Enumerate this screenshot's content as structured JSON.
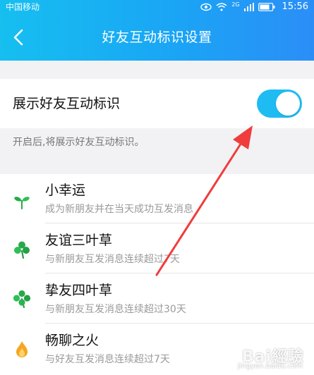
{
  "status_bar": {
    "carrier": "中国移动",
    "network": "2G",
    "time": "15:56"
  },
  "nav": {
    "title": "好友互动标识设置",
    "back_icon": "chevron-left-icon"
  },
  "toggle": {
    "label": "展示好友互动标识",
    "state": "on",
    "on_color": "#1ebcf2"
  },
  "hint": "开启后,将展示好友互动标识。",
  "items": [
    {
      "title": "小幸运",
      "desc": "成为新朋友并在当天成功互发消息",
      "icon": "sprout-icon"
    },
    {
      "title": "友谊三叶草",
      "desc": "与新朋友互发消息连续超过7天",
      "icon": "clover-three-icon"
    },
    {
      "title": "挚友四叶草",
      "desc": "与新朋友互发消息连续超过30天",
      "icon": "clover-four-icon"
    },
    {
      "title": "畅聊之火",
      "desc": "与好友互发消息连续超过7天",
      "icon": "flame-icon"
    }
  ],
  "watermark": {
    "main": "Bai經驗",
    "sub": "jingyan.baidu.com"
  },
  "colors": {
    "header_start": "#16bff0",
    "header_end": "#2b8ef7",
    "leaf_green": "#27a94a",
    "flame": "#f5a623",
    "arrow_red": "#f03c3c"
  }
}
